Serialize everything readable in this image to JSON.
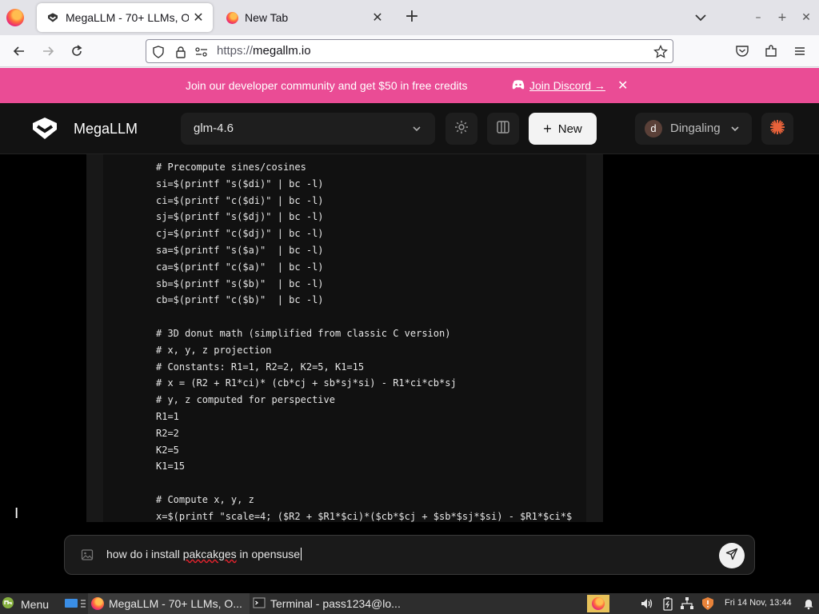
{
  "browser": {
    "tabs": [
      {
        "title": "MegaLLM - 70+ LLMs, O",
        "active": true
      },
      {
        "title": "New Tab",
        "active": false
      }
    ],
    "url_prefix": "https://",
    "url_host": "megallm.io"
  },
  "promo": {
    "text": "Join our developer community and get $50 in free credits",
    "link_label": "Join Discord →"
  },
  "app": {
    "brand": "MegaLLM",
    "model": "glm-4.6",
    "new_label": "New",
    "user_initial": "d",
    "user_name": "Dingaling"
  },
  "code": {
    "lines": [
      "# Precompute sines/cosines",
      "si=$(printf \"s($di)\" | bc -l)",
      "ci=$(printf \"c($di)\" | bc -l)",
      "sj=$(printf \"s($dj)\" | bc -l)",
      "cj=$(printf \"c($dj)\" | bc -l)",
      "sa=$(printf \"s($a)\"  | bc -l)",
      "ca=$(printf \"c($a)\"  | bc -l)",
      "sb=$(printf \"s($b)\"  | bc -l)",
      "cb=$(printf \"c($b)\"  | bc -l)",
      "",
      "# 3D donut math (simplified from classic C version)",
      "# x, y, z projection",
      "# Constants: R1=1, R2=2, K2=5, K1=15",
      "# x = (R2 + R1*ci)* (cb*cj + sb*sj*si) - R1*ci*cb*sj",
      "# y, z computed for perspective",
      "R1=1",
      "R2=2",
      "K2=5",
      "K1=15",
      "",
      "# Compute x, y, z",
      "x=$(printf \"scale=4; ($R2 + $R1*$ci)*($cb*$cj + $sb*$sj*$si) - $R1*$ci*$"
    ]
  },
  "composer": {
    "text_before": "how do i install ",
    "text_typo": "pakcakges",
    "text_after": " in opensuse"
  },
  "taskbar": {
    "menu_label": "Menu",
    "tasks": [
      "MegaLLM - 70+ LLMs, O...",
      "Terminal - pass1234@lo..."
    ],
    "clock": "Fri 14 Nov, 13:44"
  }
}
